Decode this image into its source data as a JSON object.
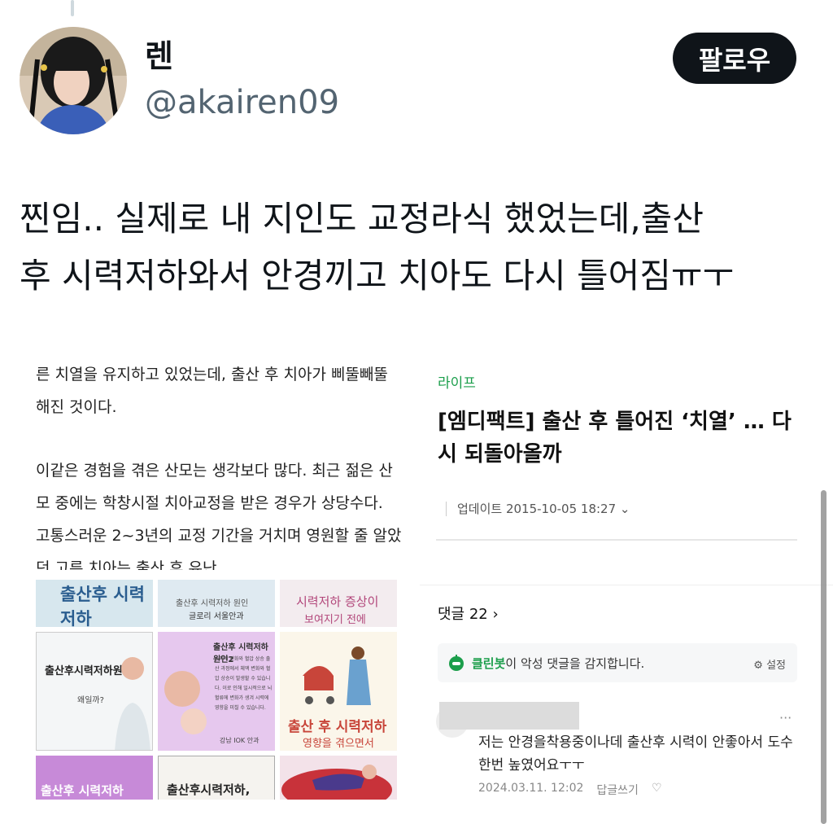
{
  "tweet": {
    "display_name": "렌",
    "handle": "@akairen09",
    "follow_label": "팔로우",
    "text": "찐임..  실제로 내 지인도 교정라식 했었는데,출산\n후 시력저하와서 안경끼고 치아도 다시 틀어짐ㅠㅜ"
  },
  "article": {
    "para1": "른 치열을 유지하고 있었는데, 출산 후 치아가 삐뚤빼뚤해진 것이다.",
    "para2": "이같은 경험을 겪은 산모는 생각보다 많다. 최근 젊은 산모 중에는 학창시절 치아교정을 받은 경우가 상당수다. 고통스러운 2~3년의 교정 기간을 거치며 영원할 줄 알았던 고른 치아는 출산 후 유난",
    "thumbs": [
      {
        "label": "출산후 시력저하",
        "sub": ""
      },
      {
        "label": "출산후 시력저하 원인",
        "sub": "글로리 서울안과"
      },
      {
        "label": "시력저하 증상이",
        "sub": "보여지기 전에"
      },
      {
        "label": "출산후시력저하원인",
        "sub": "왜일까?"
      },
      {
        "label": "출산후 시력저하 원인2",
        "sub": "• 체액 변화와 혈압 상승 출산 과정에서 체액 변화와 혈압 상승이 발생할 수 있습니다. 이로 인해 일시적으로 뇌 혈류에 변화가 생겨 시력에 영향을 미칠 수 있습니다.",
        "brand": "강남 IOK 안과"
      },
      {
        "label": "출산 후 시력저하",
        "sub": "영향을 겪으면서"
      },
      {
        "label": "출산후 시력저하",
        "sub": ""
      },
      {
        "label": "출산후시력저하,",
        "sub": ""
      },
      {
        "label": "",
        "sub": ""
      }
    ]
  },
  "news": {
    "category": "라이프",
    "title": "[엠디팩트] 출산 후 틀어진 ‘치열’ … 다시 되돌아올까",
    "update": "업데이트 2015-10-05 18:27 ⌄",
    "comment_count": "댓글 22 ›",
    "cleanbot_name": "클린봇",
    "cleanbot_rest": "이 악성 댓글을 감지합니다.",
    "cleanbot_settings": "⚙ 설정",
    "comment_text": "저는 안경을착용중이나데 출산후 시력이 안좋아서 도수한번 높였어요ㅜㅜ",
    "comment_date": "2024.03.11. 12:02",
    "reply_label": "답글쓰기",
    "more": "···"
  },
  "colors": {
    "brand_green": "#1b9e4b",
    "follow_bg": "#0f1419",
    "handle": "#536471"
  }
}
